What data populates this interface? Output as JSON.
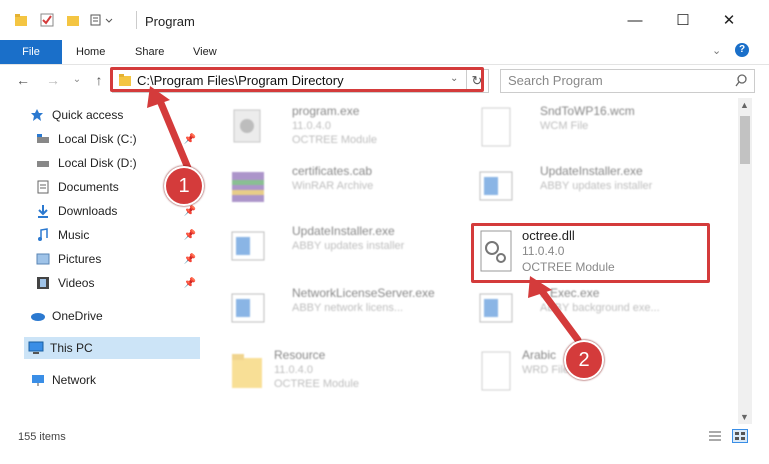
{
  "window": {
    "title": "Program"
  },
  "ribbon": {
    "tabs": [
      "File",
      "Home",
      "Share",
      "View"
    ]
  },
  "address": {
    "path": "C:\\Program Files\\Program Directory"
  },
  "search": {
    "placeholder": "Search Program"
  },
  "sidebar": {
    "items": [
      {
        "label": "Quick access"
      },
      {
        "label": "Local Disk (C:)"
      },
      {
        "label": "Local Disk (D:)"
      },
      {
        "label": "Documents"
      },
      {
        "label": "Downloads"
      },
      {
        "label": "Music"
      },
      {
        "label": "Pictures"
      },
      {
        "label": "Videos"
      },
      {
        "label": "OneDrive"
      },
      {
        "label": "This PC"
      },
      {
        "label": "Network"
      }
    ]
  },
  "files": [
    {
      "name": "program.exe",
      "line1": "11.0.4.0",
      "line2": "OCTREE Module"
    },
    {
      "name": "SndToWP16.wcm",
      "line1": "WCM File",
      "line2": ""
    },
    {
      "name": "certificates.cab",
      "line1": "WinRAR Archive",
      "line2": ""
    },
    {
      "name": "UpdateInstaller.exe",
      "line1": "ABBY updates installer",
      "line2": ""
    },
    {
      "name": "UpdateInstaller.exe",
      "line1": "ABBY updates installer",
      "line2": ""
    },
    {
      "name": "octree.dll",
      "line1": "11.0.4.0",
      "line2": "OCTREE Module"
    },
    {
      "name": "NetworkLicenseServer.exe",
      "line1": "ABBY network licens...",
      "line2": ""
    },
    {
      "name": "...Exec.exe",
      "line1": "ABBY background exe...",
      "line2": ""
    },
    {
      "name": "Resource",
      "line1": "11.0.4.0",
      "line2": "OCTREE Module"
    },
    {
      "name": "Arabic",
      "line1": "WRD File",
      "line2": ""
    }
  ],
  "status": {
    "item_count": "155 items"
  },
  "annotations": {
    "step1": "1",
    "step2": "2"
  },
  "colors": {
    "accent": "#1a6fc9",
    "highlight": "#d43b3b",
    "selected": "#cce4f7"
  }
}
